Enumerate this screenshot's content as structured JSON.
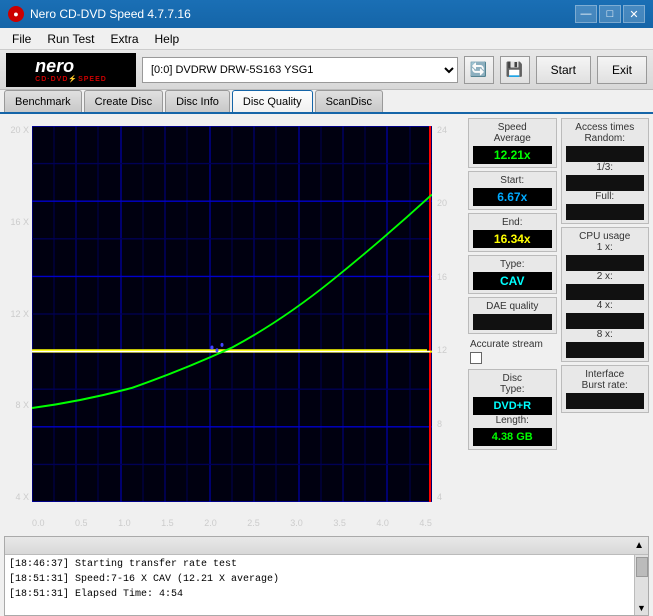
{
  "titleBar": {
    "title": "Nero CD-DVD Speed 4.7.7.16",
    "minBtn": "—",
    "maxBtn": "□",
    "closeBtn": "✕"
  },
  "menuBar": {
    "items": [
      "File",
      "Run Test",
      "Extra",
      "Help"
    ]
  },
  "toolbar": {
    "driveLabel": "[0:0]  DVDRW DRW-5S163 YSG1",
    "startBtn": "Start",
    "exitBtn": "Exit"
  },
  "tabs": {
    "items": [
      "Benchmark",
      "Create Disc",
      "Disc Info",
      "Disc Quality",
      "ScanDisc"
    ],
    "active": "Disc Quality"
  },
  "chart": {
    "yLeft": [
      "20 X",
      "16 X",
      "12 X",
      "8 X",
      "4 X"
    ],
    "yRight": [
      "24",
      "20",
      "16",
      "12",
      "8",
      "4"
    ],
    "xLabels": [
      "0.0",
      "0.5",
      "1.0",
      "1.5",
      "2.0",
      "2.5",
      "3.0",
      "3.5",
      "4.0",
      "4.5"
    ]
  },
  "stats": {
    "speed": {
      "label": "Speed",
      "average": {
        "label": "Average",
        "value": "12.21x"
      },
      "start": {
        "label": "Start:",
        "value": "6.67x"
      },
      "end": {
        "label": "End:",
        "value": "16.34x"
      },
      "type": {
        "label": "Type:",
        "value": "CAV"
      }
    },
    "daeQuality": {
      "label": "DAE quality",
      "value": ""
    },
    "accurateStream": {
      "label": "Accurate stream",
      "checked": false
    },
    "disc": {
      "label": "Disc",
      "typeLabel": "Type:",
      "typeValue": "DVD+R",
      "lengthLabel": "Length:",
      "lengthValue": "4.38 GB"
    },
    "accessTimes": {
      "label": "Access times",
      "random": {
        "label": "Random:",
        "value": ""
      },
      "oneThird": {
        "label": "1/3:",
        "value": ""
      },
      "full": {
        "label": "Full:",
        "value": ""
      }
    },
    "cpuUsage": {
      "label": "CPU usage",
      "oneX": {
        "label": "1 x:",
        "value": ""
      },
      "twoX": {
        "label": "2 x:",
        "value": ""
      },
      "fourX": {
        "label": "4 x:",
        "value": ""
      },
      "eightX": {
        "label": "8 x:",
        "value": ""
      }
    },
    "interface": {
      "label": "Interface",
      "burstRate": {
        "label": "Burst rate:",
        "value": ""
      }
    }
  },
  "log": {
    "header": "",
    "lines": [
      {
        "text": "[18:46:37]  Starting transfer rate test"
      },
      {
        "text": "[18:51:31]  Speed:7-16 X CAV (12.21 X average)"
      },
      {
        "text": "[18:51:31]  Elapsed Time: 4:54"
      }
    ]
  }
}
